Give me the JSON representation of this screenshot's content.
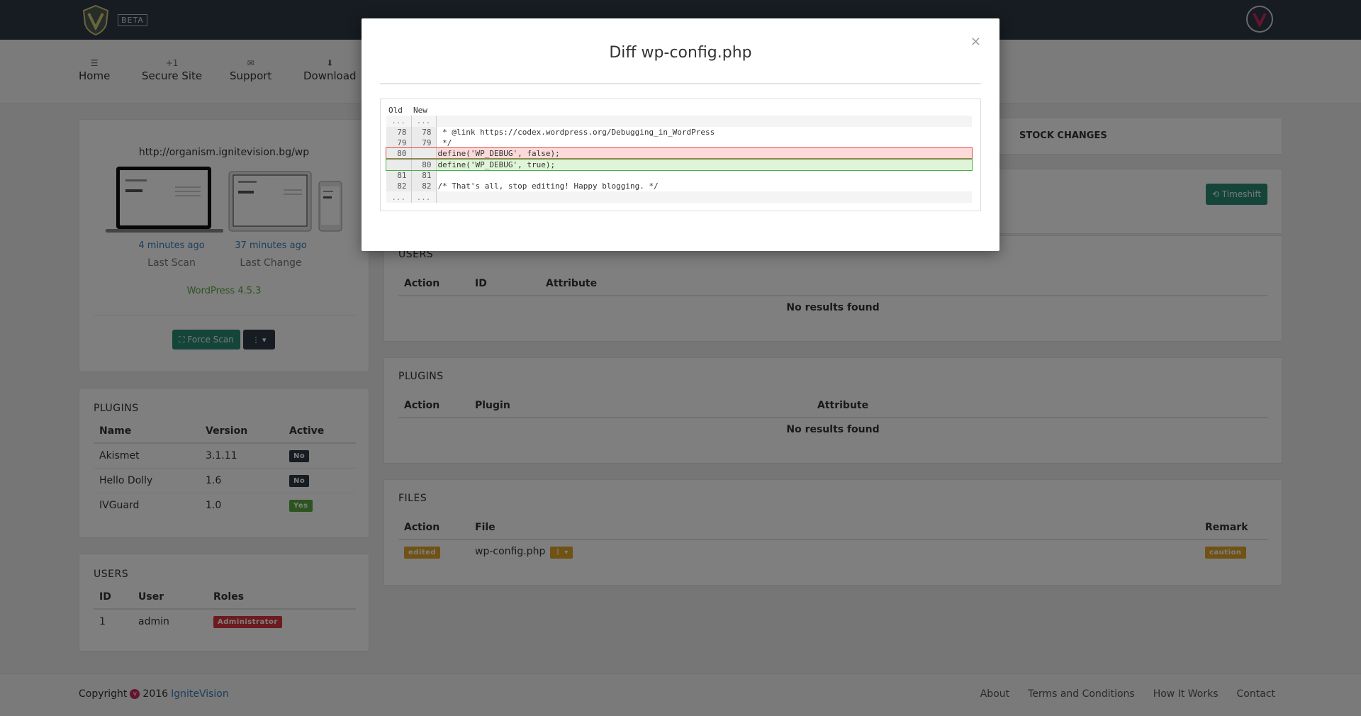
{
  "topbar": {
    "beta": "BETA",
    "avatar_icon": "v-logo-icon"
  },
  "nav": [
    {
      "icon": "list-icon",
      "glyph": "☰",
      "label": "Home"
    },
    {
      "icon": "plus-one-icon",
      "glyph": "+1",
      "label": "Secure Site"
    },
    {
      "icon": "envelope-icon",
      "glyph": "✉",
      "label": "Support"
    },
    {
      "icon": "download-icon",
      "glyph": "⬇",
      "label": "Download"
    }
  ],
  "site": {
    "url": "http://organism.ignitevision.bg/wp",
    "last_scan_time": "4 minutes ago",
    "last_scan_label": "Last Scan",
    "last_change_time": "37 minutes ago",
    "last_change_label": "Last Change",
    "wp_version": "WordPress 4.5.3",
    "force_scan": "⛶ Force Scan",
    "menu_btn": "⋮ ▾"
  },
  "plugins_side": {
    "title": "PLUGINS",
    "headers": [
      "Name",
      "Version",
      "Active"
    ],
    "rows": [
      {
        "name": "Akismet",
        "version": "3.1.11",
        "active": "No"
      },
      {
        "name": "Hello Dolly",
        "version": "1.6",
        "active": "No"
      },
      {
        "name": "IVGuard",
        "version": "1.0",
        "active": "Yes"
      }
    ]
  },
  "users_side": {
    "title": "USERS",
    "headers": [
      "ID",
      "User",
      "Roles"
    ],
    "rows": [
      {
        "id": "1",
        "user": "admin",
        "role": "Administrator"
      }
    ]
  },
  "main": {
    "stock_changes": "STOCK CHANGES",
    "timeshift": "⟲ Timeshift",
    "users": {
      "title": "USERS",
      "headers": [
        "Action",
        "ID",
        "Attribute"
      ],
      "empty": "No results found"
    },
    "plugins": {
      "title": "PLUGINS",
      "headers": [
        "Action",
        "Plugin",
        "Attribute"
      ],
      "empty": "No results found"
    },
    "files": {
      "title": "FILES",
      "headers": [
        "Action",
        "File",
        "Remark"
      ],
      "row": {
        "action": "edited",
        "file": "wp-config.php",
        "menu": "⋮ ▾",
        "remark": "caution"
      }
    }
  },
  "footer": {
    "copyright": "Copyright",
    "year": "2016",
    "brand": "IgniteVision",
    "links": [
      "About",
      "Terms and Conditions",
      "How It Works",
      "Contact"
    ]
  },
  "modal": {
    "title": "Diff wp-config.php",
    "close": "×",
    "diff_headers": {
      "old": "Old",
      "new": "New"
    },
    "lines": [
      {
        "type": "sep",
        "old": "...",
        "new": "...",
        "code": ""
      },
      {
        "type": "ctx",
        "old": "78",
        "new": "78",
        "code": " * @link https://codex.wordpress.org/Debugging_in_WordPress"
      },
      {
        "type": "ctx",
        "old": "79",
        "new": "79",
        "code": " */"
      },
      {
        "type": "del",
        "old": "80",
        "new": "",
        "code": "define('WP_DEBUG', false);"
      },
      {
        "type": "ins",
        "old": "",
        "new": "80",
        "code": "define('WP_DEBUG', true);"
      },
      {
        "type": "ctx",
        "old": "81",
        "new": "81",
        "code": ""
      },
      {
        "type": "ctx",
        "old": "82",
        "new": "82",
        "code": "/* That's all, stop editing! Happy blogging. */"
      },
      {
        "type": "sep",
        "old": "...",
        "new": "...",
        "code": ""
      }
    ]
  },
  "colors": {
    "navbar": "#2d3842",
    "teal_button": "#2b8a73",
    "green_text": "#5aa93f",
    "link_blue": "#3a7bb8",
    "badge_red": "#d9363e",
    "badge_orange": "#e1a52a"
  }
}
